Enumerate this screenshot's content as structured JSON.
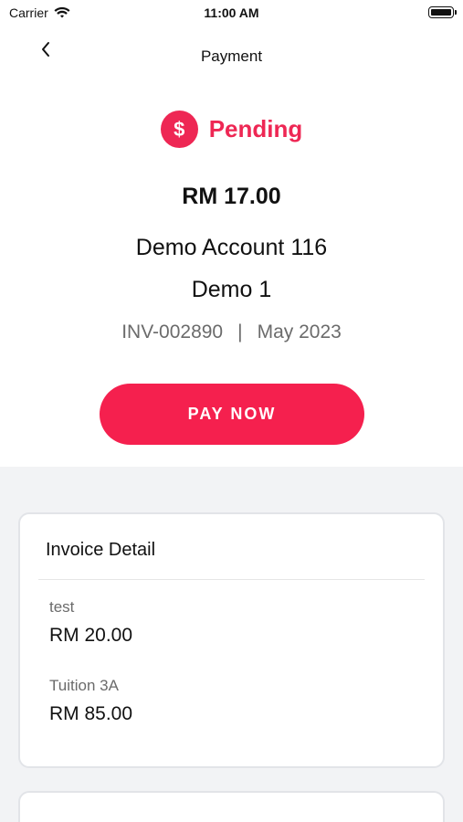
{
  "status_bar": {
    "carrier": "Carrier",
    "time": "11:00 AM"
  },
  "nav": {
    "title": "Payment"
  },
  "payment": {
    "status": "Pending",
    "status_color": "#ee2754",
    "amount": "RM 17.00",
    "account_name": "Demo Account 116",
    "student_name": "Demo 1",
    "invoice_no": "INV-002890",
    "separator": "|",
    "period": "May 2023",
    "pay_button_label": "PAY NOW"
  },
  "invoice_detail": {
    "title": "Invoice Detail",
    "items": [
      {
        "label": "test",
        "value": "RM 20.00"
      },
      {
        "label": "Tuition 3A",
        "value": "RM 85.00"
      }
    ]
  },
  "icons": {
    "back": "chevron-left-icon",
    "status": "dollar-icon",
    "wifi": "wifi-icon",
    "battery": "battery-icon"
  }
}
